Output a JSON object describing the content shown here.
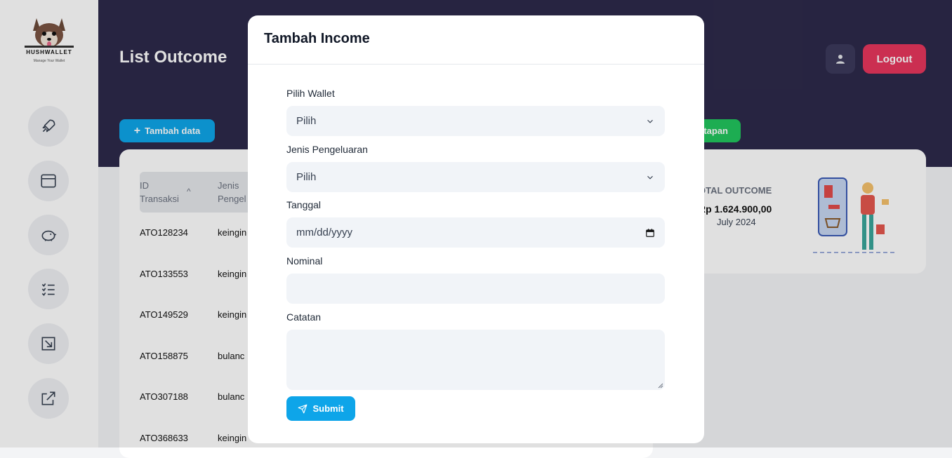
{
  "app": {
    "logo_name": "HUSHWALLET",
    "logo_tagline": "Manage Your Wallet"
  },
  "header": {
    "title": "List Outcome",
    "logout_label": "Logout",
    "add_label": "Tambah data",
    "secondary_label": "tapan"
  },
  "table": {
    "columns": [
      "ID Transaksi",
      "Jenis Pengel"
    ],
    "col_id_line1": "ID",
    "col_id_line2": "Transaksi",
    "col_type_line1": "Jenis",
    "col_type_line2": "Pengel",
    "rows": [
      {
        "id": "ATO128234",
        "type": "keingin"
      },
      {
        "id": "ATO133553",
        "type": "keingin"
      },
      {
        "id": "ATO149529",
        "type": "keingin"
      },
      {
        "id": "ATO158875",
        "type": "bulanc"
      },
      {
        "id": "ATO307188",
        "type": "bulanc"
      },
      {
        "id": "ATO368633",
        "type": "keingin"
      }
    ]
  },
  "summary": {
    "title": "OTAL OUTCOME",
    "amount": "Rp 1.624.900,00",
    "period": "July 2024"
  },
  "modal": {
    "title": "Tambah Income",
    "wallet_label": "Pilih Wallet",
    "wallet_value": "Pilih",
    "jenis_label": "Jenis Pengeluaran",
    "jenis_value": "Pilih",
    "tanggal_label": "Tanggal",
    "tanggal_placeholder": "mm/dd/yyyy",
    "nominal_label": "Nominal",
    "nominal_value": "",
    "catatan_label": "Catatan",
    "catatan_value": "",
    "submit_label": "Submit"
  },
  "icons": {
    "nav": [
      "rocket-icon",
      "window-icon",
      "piggy-bank-icon",
      "list-icon",
      "arrow-in-icon",
      "arrow-out-icon"
    ]
  },
  "colors": {
    "header_bg": "#2d2a4a",
    "primary": "#0ea5e9",
    "danger": "#e8365d",
    "success": "#22c55e"
  }
}
